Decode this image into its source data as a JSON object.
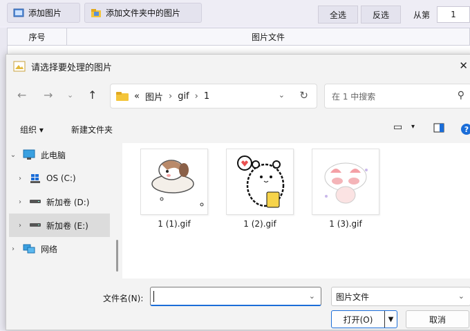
{
  "app": {
    "add_image_label": "添加图片",
    "add_folder_label": "添加文件夹中的图片",
    "select_all_label": "全选",
    "invert_label": "反选",
    "from_label": "从第",
    "page_value": "1",
    "col_index": "序号",
    "col_file": "图片文件"
  },
  "dialog": {
    "title": "请选择要处理的图片",
    "breadcrumb": [
      "图片",
      "gif",
      "1"
    ],
    "breadcrumb_prefix": "«",
    "search_placeholder": "在 1 中搜索",
    "organize_label": "组织",
    "new_folder_label": "新建文件夹",
    "tree": [
      {
        "label": "此电脑",
        "icon": "computer-icon",
        "expanded": true
      },
      {
        "label": "OS (C:)",
        "icon": "windows-drive-icon"
      },
      {
        "label": "新加卷 (D:)",
        "icon": "drive-icon"
      },
      {
        "label": "新加卷 (E:)",
        "icon": "drive-icon",
        "selected": true
      },
      {
        "label": "网络",
        "icon": "network-icon"
      }
    ],
    "files": [
      {
        "name": "1 (1).gif",
        "icon": "puppy-sticker-thumbnail"
      },
      {
        "name": "1 (2).gif",
        "icon": "bear-heart-sticker-thumbnail"
      },
      {
        "name": "1 (3).gif",
        "icon": "pink-cat-sticker-thumbnail"
      }
    ],
    "filename_label": "文件名(N):",
    "filename_value": "",
    "filetype_value": "图片文件",
    "open_label": "打开(O)",
    "cancel_label": "取消"
  },
  "colors": {
    "accent": "#1a6dd8",
    "folder": "#f4c53a",
    "dialog_bg": "#f3f3f3"
  }
}
